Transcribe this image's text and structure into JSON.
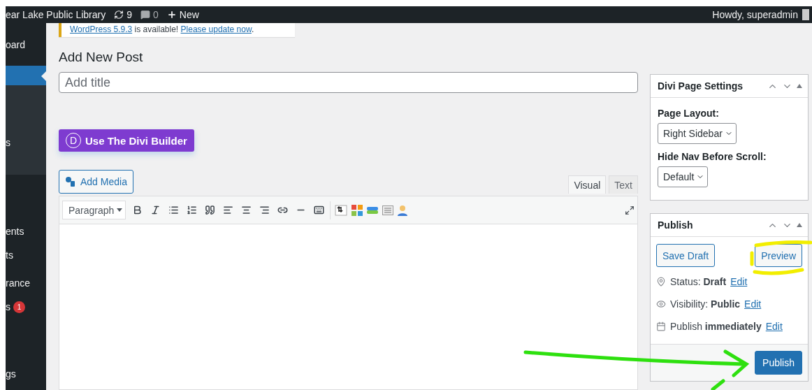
{
  "admin_bar": {
    "site_name": "ear Lake Public Library",
    "updates": "9",
    "comments": "0",
    "new_label": "New",
    "greeting": "Howdy, superadmin"
  },
  "sidebar": {
    "items": [
      {
        "label": "oard",
        "selected": false
      },
      {
        "selected": true
      },
      {
        "kind": "submenu",
        "label": "s",
        "selected": false
      },
      {
        "label": "ents",
        "selected": false
      },
      {
        "label": "ts",
        "selected": false
      },
      {
        "label": "rance",
        "selected": false
      },
      {
        "label": "s",
        "badge": "1",
        "selected": false
      },
      {
        "label": "gs",
        "selected": false
      }
    ]
  },
  "notice": {
    "version_link": "WordPress 5.9.3",
    "text": "is available!",
    "update_link": "Please update now",
    "end": "."
  },
  "heading": "Add New Post",
  "title_field": {
    "placeholder": "Add title"
  },
  "divi_button": {
    "logo": "D",
    "label": "Use The Divi Builder"
  },
  "add_media": "Add Media",
  "editor_tabs": [
    {
      "label": "Visual",
      "selected": true
    },
    {
      "label": "Text",
      "selected": false
    }
  ],
  "format_select": "Paragraph",
  "divi_settings": {
    "title": "Divi Page Settings",
    "fields": [
      {
        "label": "Page Layout:",
        "value": "Right Sidebar"
      },
      {
        "label": "Hide Nav Before Scroll:",
        "value": "Default"
      }
    ]
  },
  "publish": {
    "title": "Publish",
    "save_draft": "Save Draft",
    "preview": "Preview",
    "rows": [
      {
        "kind": "status",
        "text": "Status: **Draft**",
        "link": "Edit"
      },
      {
        "kind": "visibility",
        "text": "Visibility: **Public**",
        "link": "Edit"
      },
      {
        "kind": "schedule",
        "text": "Publish **immediately**",
        "link": "Edit"
      }
    ],
    "publish_button": "Publish"
  }
}
